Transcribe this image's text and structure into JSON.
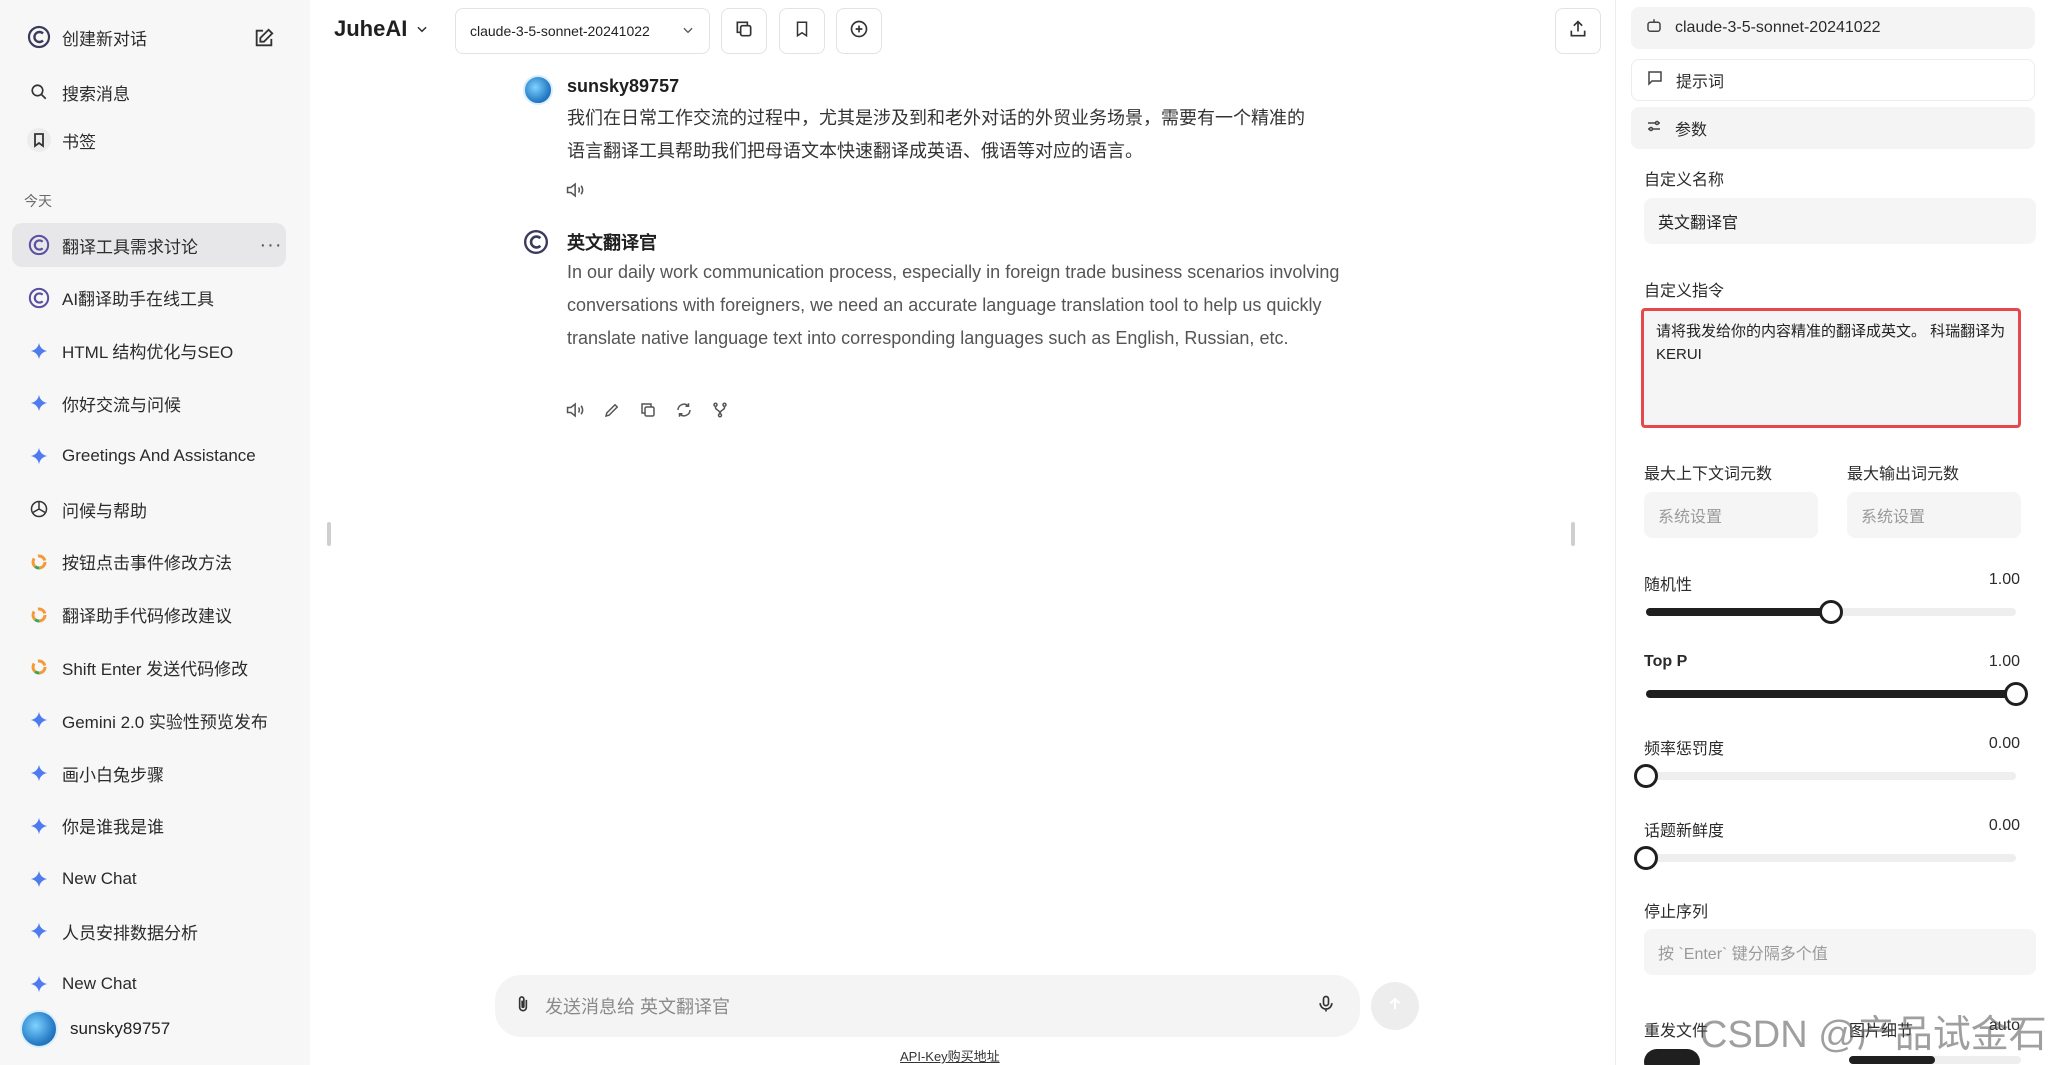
{
  "sidebar": {
    "new_chat": "创建新对话",
    "search": "搜索消息",
    "bookmarks": "书签",
    "section_today": "今天",
    "more": "···",
    "items": [
      {
        "label": "翻译工具需求讨论",
        "icon": "juhe-logo-icon"
      },
      {
        "label": "AI翻译助手在线工具",
        "icon": "juhe-logo-icon"
      },
      {
        "label": "HTML 结构优化与SEO",
        "icon": "gemini-sparkle-icon"
      },
      {
        "label": "你好交流与问候",
        "icon": "gemini-sparkle-icon"
      },
      {
        "label": "Greetings And Assistance",
        "icon": "gemini-sparkle-icon"
      },
      {
        "label": "问候与帮助",
        "icon": "openai-logo-icon"
      },
      {
        "label": "按钮点击事件修改方法",
        "icon": "colorful-ring-icon"
      },
      {
        "label": "翻译助手代码修改建议",
        "icon": "colorful-ring-icon"
      },
      {
        "label": "Shift Enter 发送代码修改",
        "icon": "colorful-ring-icon"
      },
      {
        "label": "Gemini 2.0 实验性预览发布",
        "icon": "gemini-sparkle-icon"
      },
      {
        "label": "画小白兔步骤",
        "icon": "gemini-sparkle-icon"
      },
      {
        "label": "你是谁我是谁",
        "icon": "gemini-sparkle-icon"
      },
      {
        "label": "New Chat",
        "icon": "gemini-sparkle-icon"
      },
      {
        "label": "人员安排数据分析",
        "icon": "gemini-sparkle-icon"
      },
      {
        "label": "New Chat",
        "icon": "gemini-sparkle-icon"
      }
    ],
    "username": "sunsky89757"
  },
  "header": {
    "brand": "JuheAI",
    "model": "claude-3-5-sonnet-20241022"
  },
  "messages": {
    "user_name": "sunsky89757",
    "user_text_line1": "我们在日常工作交流的过程中，尤其是涉及到和老外对话的外贸业务场景，需要有一个精准的",
    "user_text_line2": "语言翻译工具帮助我们把母语文本快速翻译成英语、俄语等对应的语言。",
    "bot_name": "英文翻译官",
    "bot_text": "In our daily work communication process, especially in foreign trade business scenarios involving conversations with foreigners, we need an accurate language translation tool to help us quickly translate native language text into corresponding languages such as English, Russian, etc."
  },
  "composer": {
    "placeholder": "发送消息给 英文翻译官",
    "api_link": "API-Key购买地址"
  },
  "panel": {
    "model": "claude-3-5-sonnet-20241022",
    "prompts": "提示词",
    "params": "参数",
    "custom_name_label": "自定义名称",
    "custom_name_value": "英文翻译官",
    "custom_instruction_label": "自定义指令",
    "custom_instruction_value": "请将我发给你的内容精准的翻译成英文。 科瑞翻译为KERUI",
    "max_context_label": "最大上下文词元数",
    "max_output_label": "最大输出词元数",
    "max_context_placeholder": "系统设置",
    "max_output_placeholder": "系统设置",
    "temperature_label": "随机性",
    "temperature_value": "1.00",
    "temperature_level": 0.5,
    "top_p_label": "Top P",
    "top_p_value": "1.00",
    "top_p_level": 1.0,
    "freq_penalty_label": "频率惩罚度",
    "freq_penalty_value": "0.00",
    "freq_penalty_level": 0.0,
    "presence_label": "话题新鲜度",
    "presence_value": "0.00",
    "presence_level": 0.0,
    "stop_label": "停止序列",
    "stop_placeholder": "按 `Enter` 键分隔多个值",
    "resend_files_label": "重发文件",
    "image_detail_label": "图片细节",
    "image_detail_value": "auto"
  },
  "watermark": "CSDN @产品试金石"
}
